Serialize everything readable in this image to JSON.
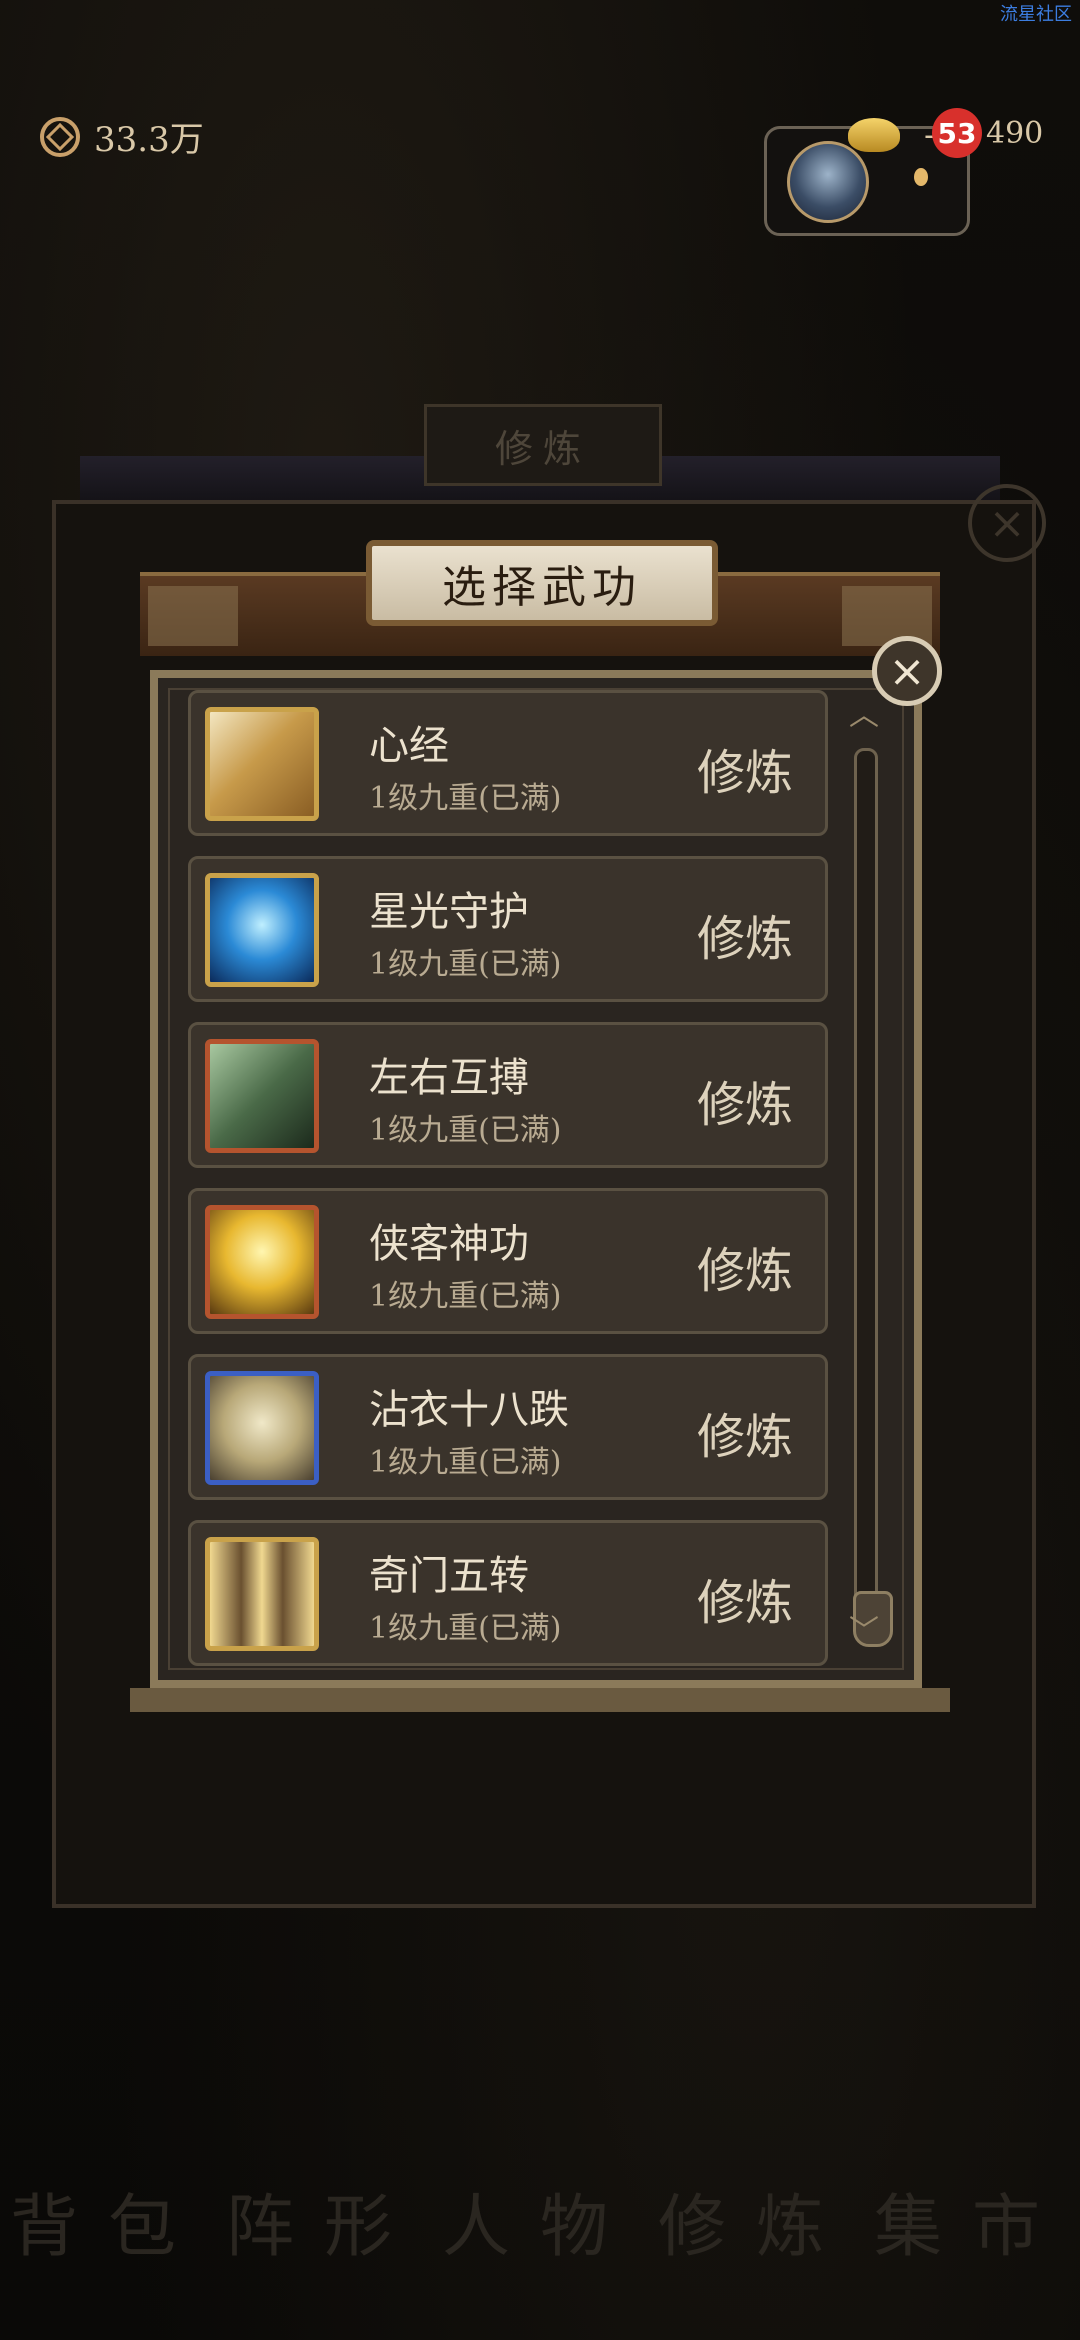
{
  "top": {
    "watermark": "流星社区",
    "currency_value": "33.3万",
    "gold_value": "490",
    "gold_prefix": "-",
    "badge_count": "53"
  },
  "background_tab": "修炼",
  "dialog": {
    "title": "选择武功",
    "close_symbol": "×",
    "items": [
      {
        "name": "心经",
        "level": "1级九重(已满)",
        "action": "修炼",
        "icon": "scroll-icon"
      },
      {
        "name": "星光守护",
        "level": "1级九重(已满)",
        "action": "修炼",
        "icon": "starlight-icon"
      },
      {
        "name": "左右互搏",
        "level": "1级九重(已满)",
        "action": "修炼",
        "icon": "dual-fighters-icon"
      },
      {
        "name": "侠客神功",
        "level": "1级九重(已满)",
        "action": "修炼",
        "icon": "hero-martial-icon"
      },
      {
        "name": "沾衣十八跌",
        "level": "1级九重(已满)",
        "action": "修炼",
        "icon": "kick-icon"
      },
      {
        "name": "奇门五转",
        "level": "1级九重(已满)",
        "action": "修炼",
        "icon": "shadow-clones-icon"
      }
    ]
  },
  "bottom_nav": [
    "背包",
    "阵形",
    "人物",
    "修炼",
    "集市"
  ],
  "colors": {
    "accent": "#c9a24a",
    "badge": "#d8302c",
    "panel": "#3a332b"
  }
}
